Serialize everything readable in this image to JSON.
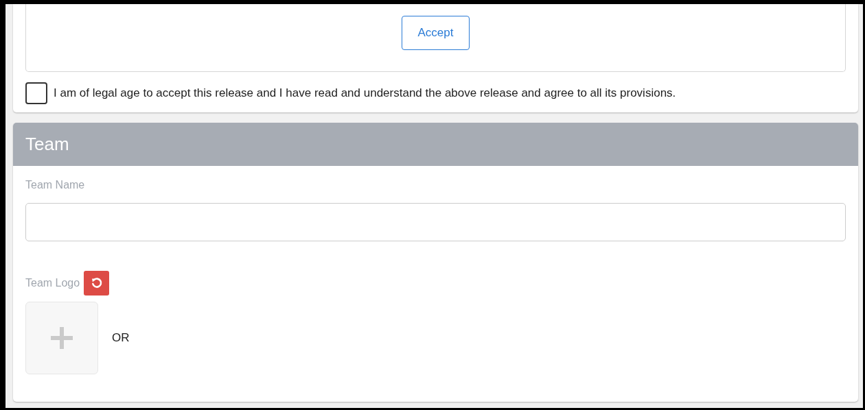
{
  "release": {
    "accept_button": "Accept",
    "agreement": {
      "label": "I am of legal age to accept this release and I have read and understand the above release and agree to all its provisions.",
      "checked": false
    }
  },
  "team": {
    "title": "Team",
    "fields": [
      {
        "kind": "text",
        "label": "Team Name"
      }
    ],
    "logo": {
      "label": "Team Logo",
      "separator": "OR"
    }
  }
}
